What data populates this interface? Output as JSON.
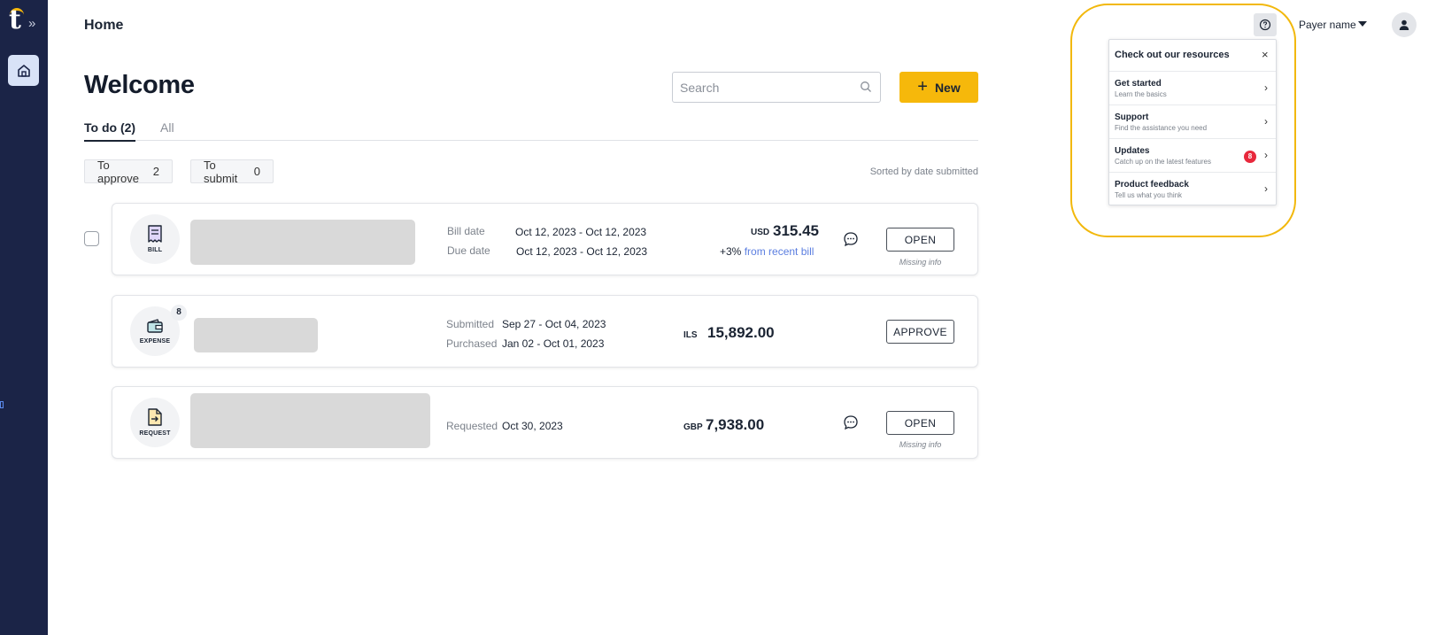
{
  "sidebar": {
    "logo_text": "t",
    "expand_glyph": "»",
    "items": [
      {
        "name": "home",
        "icon": "home-icon",
        "active": true
      }
    ]
  },
  "header": {
    "breadcrumb": "Home",
    "title": "Welcome",
    "search_placeholder": "Search",
    "new_button": "New",
    "payer_name": "Payer name"
  },
  "tabs": [
    {
      "label": "To do (2)",
      "active": true
    },
    {
      "label": "All",
      "active": false
    }
  ],
  "filters": {
    "to_approve": {
      "label": "To approve",
      "count": "2"
    },
    "to_submit": {
      "label": "To submit",
      "count": "0"
    },
    "sorted_by": "Sorted by date submitted"
  },
  "items": [
    {
      "type": "BILL",
      "meta": [
        {
          "label": "Bill date",
          "value": "Oct 12, 2023 - Oct 12, 2023"
        },
        {
          "label": "Due date",
          "value": "Oct 12, 2023 - Oct 12, 2023"
        }
      ],
      "currency": "USD",
      "amount": "315.45",
      "delta": "+3%",
      "delta_link": "from recent bill",
      "action": "OPEN",
      "note": "Missing info"
    },
    {
      "type": "EXPENSE",
      "count": "8",
      "meta": [
        {
          "label": "Submitted",
          "value": "Sep 27 - Oct 04, 2023"
        },
        {
          "label": "Purchased",
          "value": "Jan 02 - Oct 01, 2023"
        }
      ],
      "currency": "ILS",
      "amount": "15,892.00",
      "action": "APPROVE"
    },
    {
      "type": "REQUEST",
      "meta": [
        {
          "label": "Requested",
          "value": "Oct 30, 2023"
        }
      ],
      "currency": "GBP",
      "amount": "7,938.00",
      "action": "OPEN",
      "note": "Missing info"
    }
  ],
  "resources": {
    "title": "Check out our resources",
    "close": "×",
    "items": [
      {
        "title": "Get started",
        "subtitle": "Learn the basics"
      },
      {
        "title": "Support",
        "subtitle": "Find the assistance you need"
      },
      {
        "title": "Updates",
        "subtitle": "Catch up on the latest features",
        "badge": "8"
      },
      {
        "title": "Product feedback",
        "subtitle": "Tell us what you think"
      }
    ]
  },
  "colors": {
    "sidebar": "#1b2447",
    "accent": "#f6b80b",
    "link": "#5b7ee0",
    "badge": "#e8283c"
  }
}
